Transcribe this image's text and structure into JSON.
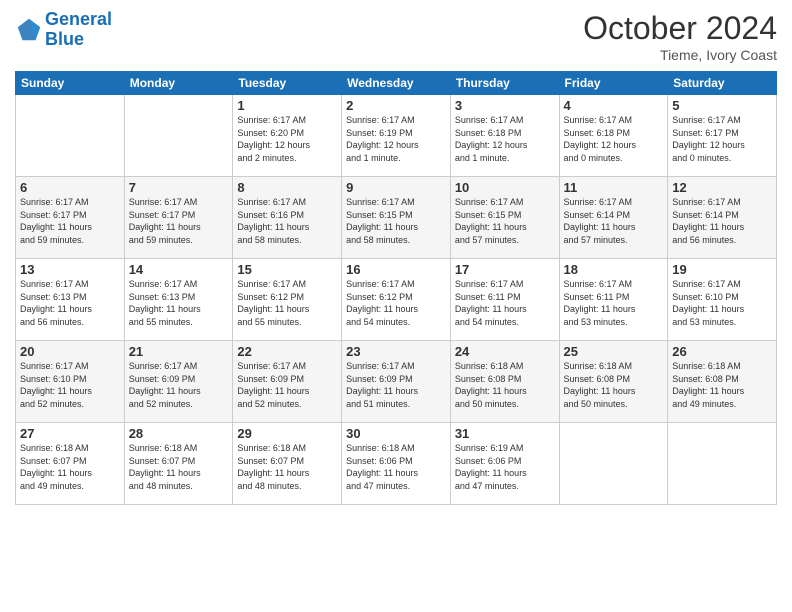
{
  "header": {
    "logo_line1": "General",
    "logo_line2": "Blue",
    "month_title": "October 2024",
    "location": "Tieme, Ivory Coast"
  },
  "weekdays": [
    "Sunday",
    "Monday",
    "Tuesday",
    "Wednesday",
    "Thursday",
    "Friday",
    "Saturday"
  ],
  "weeks": [
    [
      {
        "day": "",
        "info": ""
      },
      {
        "day": "",
        "info": ""
      },
      {
        "day": "1",
        "info": "Sunrise: 6:17 AM\nSunset: 6:20 PM\nDaylight: 12 hours\nand 2 minutes."
      },
      {
        "day": "2",
        "info": "Sunrise: 6:17 AM\nSunset: 6:19 PM\nDaylight: 12 hours\nand 1 minute."
      },
      {
        "day": "3",
        "info": "Sunrise: 6:17 AM\nSunset: 6:18 PM\nDaylight: 12 hours\nand 1 minute."
      },
      {
        "day": "4",
        "info": "Sunrise: 6:17 AM\nSunset: 6:18 PM\nDaylight: 12 hours\nand 0 minutes."
      },
      {
        "day": "5",
        "info": "Sunrise: 6:17 AM\nSunset: 6:17 PM\nDaylight: 12 hours\nand 0 minutes."
      }
    ],
    [
      {
        "day": "6",
        "info": "Sunrise: 6:17 AM\nSunset: 6:17 PM\nDaylight: 11 hours\nand 59 minutes."
      },
      {
        "day": "7",
        "info": "Sunrise: 6:17 AM\nSunset: 6:17 PM\nDaylight: 11 hours\nand 59 minutes."
      },
      {
        "day": "8",
        "info": "Sunrise: 6:17 AM\nSunset: 6:16 PM\nDaylight: 11 hours\nand 58 minutes."
      },
      {
        "day": "9",
        "info": "Sunrise: 6:17 AM\nSunset: 6:15 PM\nDaylight: 11 hours\nand 58 minutes."
      },
      {
        "day": "10",
        "info": "Sunrise: 6:17 AM\nSunset: 6:15 PM\nDaylight: 11 hours\nand 57 minutes."
      },
      {
        "day": "11",
        "info": "Sunrise: 6:17 AM\nSunset: 6:14 PM\nDaylight: 11 hours\nand 57 minutes."
      },
      {
        "day": "12",
        "info": "Sunrise: 6:17 AM\nSunset: 6:14 PM\nDaylight: 11 hours\nand 56 minutes."
      }
    ],
    [
      {
        "day": "13",
        "info": "Sunrise: 6:17 AM\nSunset: 6:13 PM\nDaylight: 11 hours\nand 56 minutes."
      },
      {
        "day": "14",
        "info": "Sunrise: 6:17 AM\nSunset: 6:13 PM\nDaylight: 11 hours\nand 55 minutes."
      },
      {
        "day": "15",
        "info": "Sunrise: 6:17 AM\nSunset: 6:12 PM\nDaylight: 11 hours\nand 55 minutes."
      },
      {
        "day": "16",
        "info": "Sunrise: 6:17 AM\nSunset: 6:12 PM\nDaylight: 11 hours\nand 54 minutes."
      },
      {
        "day": "17",
        "info": "Sunrise: 6:17 AM\nSunset: 6:11 PM\nDaylight: 11 hours\nand 54 minutes."
      },
      {
        "day": "18",
        "info": "Sunrise: 6:17 AM\nSunset: 6:11 PM\nDaylight: 11 hours\nand 53 minutes."
      },
      {
        "day": "19",
        "info": "Sunrise: 6:17 AM\nSunset: 6:10 PM\nDaylight: 11 hours\nand 53 minutes."
      }
    ],
    [
      {
        "day": "20",
        "info": "Sunrise: 6:17 AM\nSunset: 6:10 PM\nDaylight: 11 hours\nand 52 minutes."
      },
      {
        "day": "21",
        "info": "Sunrise: 6:17 AM\nSunset: 6:09 PM\nDaylight: 11 hours\nand 52 minutes."
      },
      {
        "day": "22",
        "info": "Sunrise: 6:17 AM\nSunset: 6:09 PM\nDaylight: 11 hours\nand 52 minutes."
      },
      {
        "day": "23",
        "info": "Sunrise: 6:17 AM\nSunset: 6:09 PM\nDaylight: 11 hours\nand 51 minutes."
      },
      {
        "day": "24",
        "info": "Sunrise: 6:18 AM\nSunset: 6:08 PM\nDaylight: 11 hours\nand 50 minutes."
      },
      {
        "day": "25",
        "info": "Sunrise: 6:18 AM\nSunset: 6:08 PM\nDaylight: 11 hours\nand 50 minutes."
      },
      {
        "day": "26",
        "info": "Sunrise: 6:18 AM\nSunset: 6:08 PM\nDaylight: 11 hours\nand 49 minutes."
      }
    ],
    [
      {
        "day": "27",
        "info": "Sunrise: 6:18 AM\nSunset: 6:07 PM\nDaylight: 11 hours\nand 49 minutes."
      },
      {
        "day": "28",
        "info": "Sunrise: 6:18 AM\nSunset: 6:07 PM\nDaylight: 11 hours\nand 48 minutes."
      },
      {
        "day": "29",
        "info": "Sunrise: 6:18 AM\nSunset: 6:07 PM\nDaylight: 11 hours\nand 48 minutes."
      },
      {
        "day": "30",
        "info": "Sunrise: 6:18 AM\nSunset: 6:06 PM\nDaylight: 11 hours\nand 47 minutes."
      },
      {
        "day": "31",
        "info": "Sunrise: 6:19 AM\nSunset: 6:06 PM\nDaylight: 11 hours\nand 47 minutes."
      },
      {
        "day": "",
        "info": ""
      },
      {
        "day": "",
        "info": ""
      }
    ]
  ]
}
